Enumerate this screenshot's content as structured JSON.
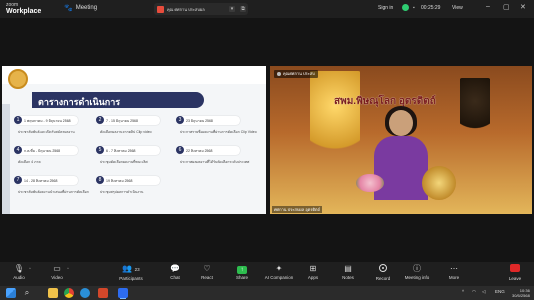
{
  "app": {
    "logo_top": "zoom",
    "logo_bottom": "Workplace"
  },
  "header": {
    "meeting_label": "Meeting",
    "share_pill": "คุณ ศศกาน ประสบผล",
    "signin": "Sign in",
    "timer": "00:25:29",
    "view": "View"
  },
  "slide": {
    "title": "ตารางการดำเนินการ",
    "cards": [
      {
        "num": "1",
        "date": "1 พฤษภาคม - 9 มิถุนายน 2568",
        "text": "ประชาสัมพันธ์และเปิดรับสมัครผลงาน"
      },
      {
        "num": "2",
        "date": "7 - 15 มิถุนายน 2568",
        "text": "คัดเลือกผลงานจากคลิป Clip video"
      },
      {
        "num": "3",
        "date": "23 มิถุนายน 2568",
        "text": "ประกาศรายชื่อผลงานที่ผ่านการคัดเลือก Clip Video"
      },
      {
        "num": "4",
        "date": "ก.ค.ที่ม - มิถุนายน 2568",
        "text": "คัดเลือก 4 ภาค"
      },
      {
        "num": "5",
        "date": "6 - 7 สิงหาคม 2568",
        "text": "ประชุมคัดเลือกผลงานที่ชนะเลิศ"
      },
      {
        "num": "6",
        "date": "22 สิงหาคม 2568",
        "text": "ประกาศผลผลงานที่ได้รับคัดเลือกระดับประเทศ"
      },
      {
        "num": "7",
        "date": "14 - 28 สิงหาคม 2568",
        "text": "ประชาสัมพันธ์ผลงานนำเสนอที่ผ่านการคัดเลือก"
      },
      {
        "num": "8",
        "date": "19 สิงหาคม 2568",
        "text": "ประชุมสรุปผลการดำเนินงาน"
      }
    ]
  },
  "video": {
    "name_tag": "คุณศศกาน ประสบ",
    "title": "สพม.พิษณุโลก อุตรดิตถ์",
    "footer": "ศศกาน ประสบผล อุตรดิตถ์"
  },
  "toolbar": {
    "audio": "Audio",
    "video": "Video",
    "participants": "Participants",
    "participants_count": "23",
    "chat": "Chat",
    "react": "React",
    "share": "Share",
    "ai": "AI Companion",
    "apps": "Apps",
    "notes": "Notes",
    "record": "Record",
    "meeting_info": "Meeting info",
    "more": "More",
    "leave": "Leave"
  },
  "taskbar": {
    "lang": "ENG",
    "time": "10:36",
    "date": "30/5/2568"
  },
  "colors": {
    "accent_green": "#2dbd4e",
    "leave_red": "#e02828",
    "slide_navy": "#2b3463"
  }
}
